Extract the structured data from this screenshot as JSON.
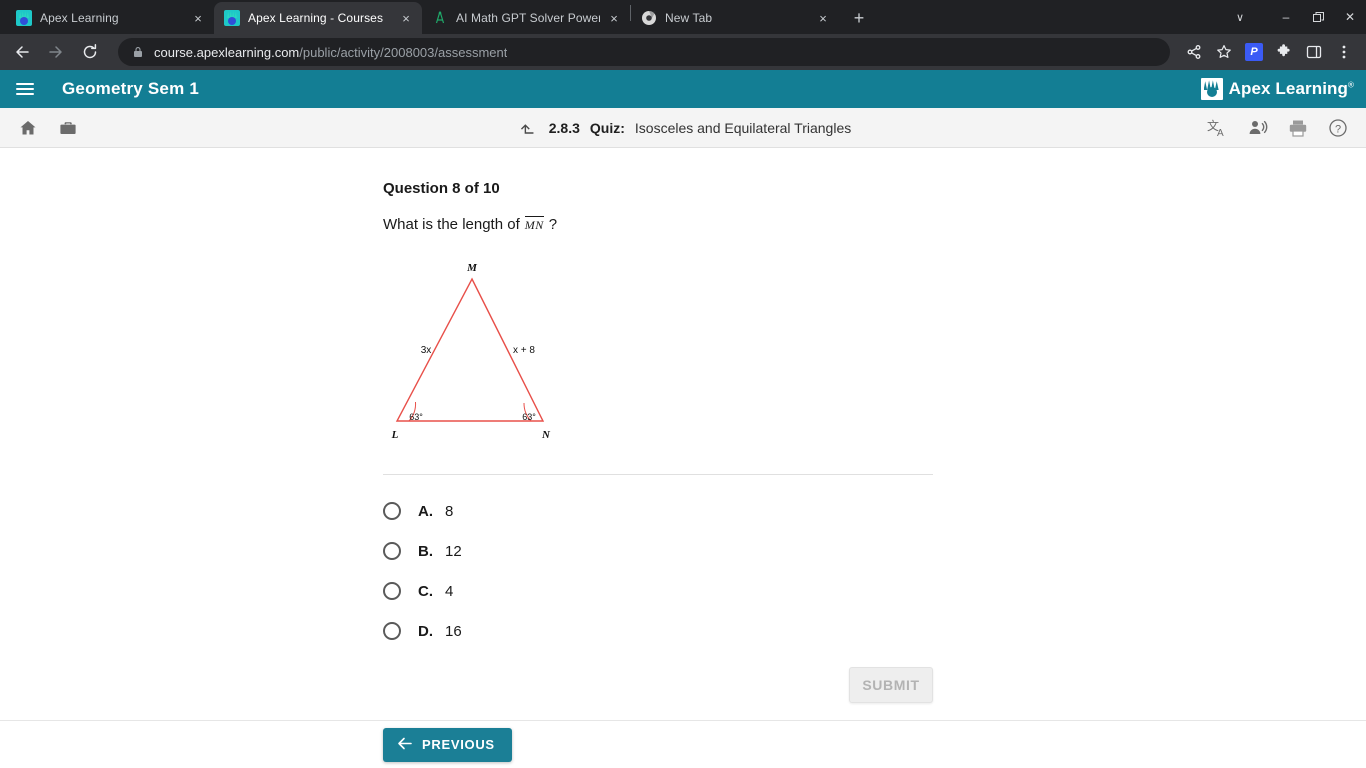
{
  "browser": {
    "tabs": [
      {
        "title": "Apex Learning",
        "favicon": "apex-favicon",
        "active": false
      },
      {
        "title": "Apex Learning - Courses",
        "favicon": "apex-favicon",
        "active": true
      },
      {
        "title": "AI Math GPT Solver Powered by",
        "favicon": "math-gpt-favicon",
        "active": false
      },
      {
        "title": "New Tab",
        "favicon": "chrome-favicon",
        "active": false
      }
    ],
    "new_tab_label": "+",
    "close_label": "×",
    "window_controls": {
      "list_tabs": "∨",
      "minimize": "–",
      "maximize": "❐",
      "close": "✕"
    },
    "omnibox": {
      "domain": "course.apexlearning.com",
      "path": "/public/activity/2008003/assessment",
      "lock_icon": "lock-icon"
    },
    "toolbar_icons": [
      "share-icon",
      "bookmark-star-icon",
      "extension-p-icon",
      "extensions-puzzle-icon",
      "side-panel-icon",
      "chrome-menu-icon"
    ],
    "ext_badge_label": "P",
    "nav": {
      "back": "back-arrow-icon",
      "forward": "forward-arrow-icon",
      "reload": "reload-icon"
    }
  },
  "header": {
    "menu_icon": "hamburger-menu-icon",
    "course_title": "Geometry Sem 1",
    "logo_text": "Apex Learning",
    "logo_reg": "®",
    "bg_color": "#137E94"
  },
  "activity_bar": {
    "left_icons": [
      "home-icon",
      "briefcase-icon"
    ],
    "upload_icon": "turn-in-icon",
    "number": "2.8.3",
    "kind": "Quiz:",
    "name": "Isosceles and Equilateral Triangles",
    "right_icons": [
      "translate-icon",
      "read-aloud-icon",
      "print-icon",
      "help-icon"
    ]
  },
  "question": {
    "counter": "Question 8 of 10",
    "prompt_before": "What is the length of",
    "segment": "MN",
    "prompt_after": "?"
  },
  "figure": {
    "vertices": {
      "top": "M",
      "bottom_left": "L",
      "bottom_right": "N"
    },
    "side_left_label": "3x",
    "side_right_label": "x + 8",
    "angle_left": "63°",
    "angle_right": "63°",
    "stroke_color": "#e8504a"
  },
  "options": [
    {
      "letter": "A.",
      "text": "8",
      "selected": false
    },
    {
      "letter": "B.",
      "text": "12",
      "selected": false
    },
    {
      "letter": "C.",
      "text": "4",
      "selected": false
    },
    {
      "letter": "D.",
      "text": "16",
      "selected": false
    }
  ],
  "buttons": {
    "submit_label": "SUBMIT",
    "submit_disabled": true,
    "previous_label": "PREVIOUS",
    "previous_icon": "arrow-left-icon",
    "previous_color": "#1B7F96"
  }
}
